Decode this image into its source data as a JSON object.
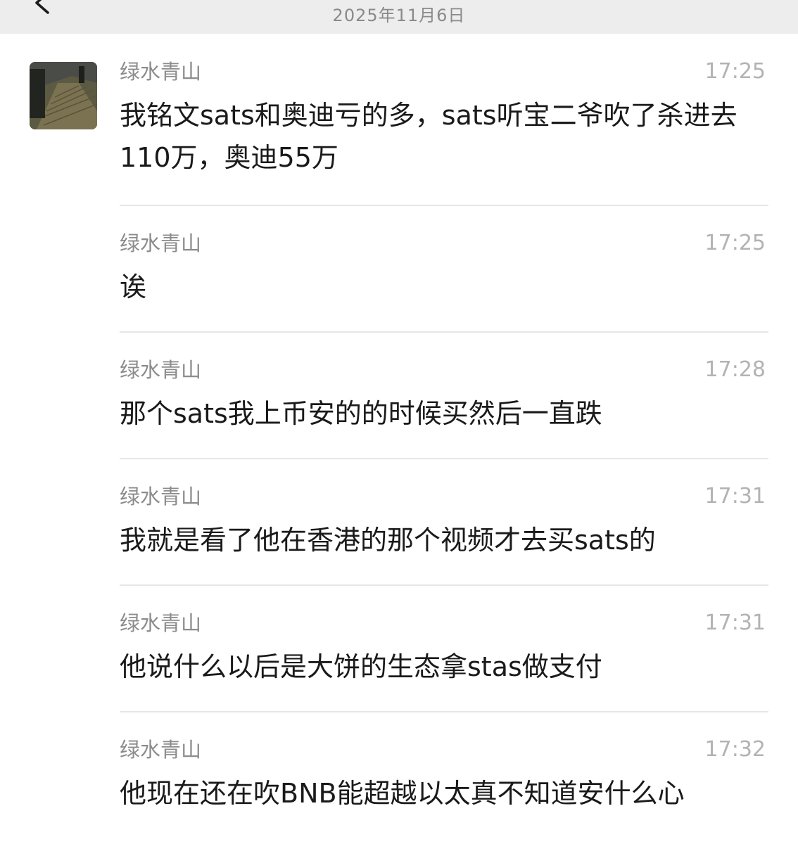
{
  "header": {
    "date": "2025年11月6日"
  },
  "messages": [
    {
      "sender": "绿水青山",
      "time": "17:25",
      "text": "我铭文sats和奥迪亏的多，sats听宝二爷吹了杀进去110万，奥迪55万"
    },
    {
      "sender": "绿水青山",
      "time": "17:25",
      "text": "诶"
    },
    {
      "sender": "绿水青山",
      "time": "17:28",
      "text": "那个sats我上币安的的时候买然后一直跌"
    },
    {
      "sender": "绿水青山",
      "time": "17:31",
      "text": "我就是看了他在香港的那个视频才去买sats的"
    },
    {
      "sender": "绿水青山",
      "time": "17:31",
      "text": "他说什么以后是大饼的生态拿stas做支付"
    },
    {
      "sender": "绿水青山",
      "time": "17:32",
      "text": "他现在还在吹BNB能超越以太真不知道安什么心"
    }
  ]
}
